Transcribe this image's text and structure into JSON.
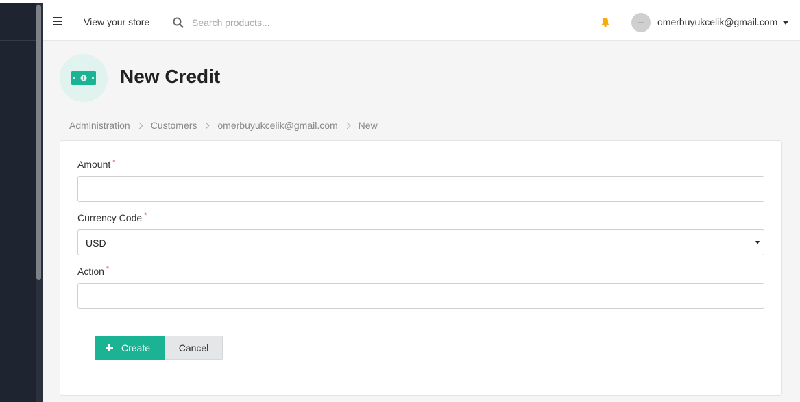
{
  "header": {
    "view_store": "View your store",
    "search_placeholder": "Search products...",
    "user_email": "omerbuyukcelik@gmail.com"
  },
  "page": {
    "title": "New Credit",
    "title_icon": "money-bill-icon"
  },
  "breadcrumb": [
    "Administration",
    "Customers",
    "omerbuyukcelik@gmail.com",
    "New"
  ],
  "form": {
    "amount": {
      "label": "Amount",
      "required_mark": "*",
      "value": ""
    },
    "currency_code": {
      "label": "Currency Code",
      "required_mark": "*",
      "value": "USD"
    },
    "action": {
      "label": "Action",
      "required_mark": "*",
      "value": ""
    }
  },
  "buttons": {
    "create": "Create",
    "cancel": "Cancel"
  },
  "colors": {
    "accent": "#1ab394",
    "sidebar": "#1e2530",
    "bell": "#f8ac10",
    "required": "#d9534f"
  },
  "icons": {
    "menu": "hamburger-icon",
    "search": "search-icon",
    "notifications": "bell-icon",
    "user_menu": "caret-down-icon",
    "create": "plus-icon"
  }
}
